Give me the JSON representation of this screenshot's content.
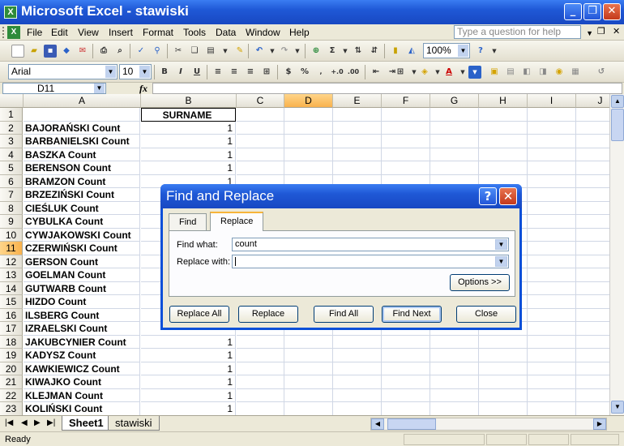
{
  "window": {
    "title": "Microsoft Excel - stawiski",
    "app_icon": "X"
  },
  "menu": {
    "items": [
      "File",
      "Edit",
      "View",
      "Insert",
      "Format",
      "Tools",
      "Data",
      "Window",
      "Help"
    ],
    "question_placeholder": "Type a question for help"
  },
  "toolbar": {
    "zoom": "100%",
    "font_name": "Arial",
    "font_size": "10"
  },
  "formula": {
    "name_box": "D11",
    "fx": "fx",
    "content": ""
  },
  "sheet": {
    "columns": [
      "A",
      "B",
      "C",
      "D",
      "E",
      "F",
      "G",
      "H",
      "I",
      "J"
    ],
    "selected_column": "D",
    "selected_row": 11,
    "header_b": "SURNAME",
    "rows": [
      {
        "n": 1,
        "a": "",
        "b": ""
      },
      {
        "n": 2,
        "a": "BAJORAŃSKI Count",
        "b": "1"
      },
      {
        "n": 3,
        "a": "BARBANIELSKI Count",
        "b": "1"
      },
      {
        "n": 4,
        "a": "BASZKA Count",
        "b": "1"
      },
      {
        "n": 5,
        "a": "BERENSON Count",
        "b": "1"
      },
      {
        "n": 6,
        "a": "BRAMZON Count",
        "b": "1"
      },
      {
        "n": 7,
        "a": "BRZEZIŃSKI Count",
        "b": ""
      },
      {
        "n": 8,
        "a": "CIEŚLUK Count",
        "b": ""
      },
      {
        "n": 9,
        "a": "CYBULKA Count",
        "b": ""
      },
      {
        "n": 10,
        "a": "CYWJAKOWSKI Count",
        "b": ""
      },
      {
        "n": 11,
        "a": "CZERWIŃSKI Count",
        "b": ""
      },
      {
        "n": 12,
        "a": "GERSON Count",
        "b": ""
      },
      {
        "n": 13,
        "a": "GOELMAN Count",
        "b": ""
      },
      {
        "n": 14,
        "a": "GUTWARB Count",
        "b": ""
      },
      {
        "n": 15,
        "a": "HIZDO Count",
        "b": ""
      },
      {
        "n": 16,
        "a": "ILSBERG Count",
        "b": ""
      },
      {
        "n": 17,
        "a": "IZRAELSKI Count",
        "b": ""
      },
      {
        "n": 18,
        "a": "JAKUBCYNIER Count",
        "b": "1"
      },
      {
        "n": 19,
        "a": "KADYSZ Count",
        "b": "1"
      },
      {
        "n": 20,
        "a": "KAWKIEWICZ Count",
        "b": "1"
      },
      {
        "n": 21,
        "a": "KIWAJKO Count",
        "b": "1"
      },
      {
        "n": 22,
        "a": "KLEJMAN Count",
        "b": "1"
      },
      {
        "n": 23,
        "a": "KOLIŃSKI Count",
        "b": "1"
      }
    ],
    "tabs": [
      "Sheet1",
      "stawiski"
    ],
    "active_tab": "Sheet1"
  },
  "status": {
    "text": "Ready"
  },
  "dialog": {
    "title": "Find and Replace",
    "help_glyph": "?",
    "close_glyph": "✕",
    "tabs": [
      "Find",
      "Replace"
    ],
    "active_tab": "Replace",
    "find_label": "Find what:",
    "find_value": "count",
    "replace_label": "Replace with:",
    "replace_value": "",
    "options_button": "Options >>",
    "buttons": {
      "replace_all": "Replace All",
      "replace": "Replace",
      "find_all": "Find All",
      "find_next": "Find Next",
      "close": "Close"
    }
  }
}
